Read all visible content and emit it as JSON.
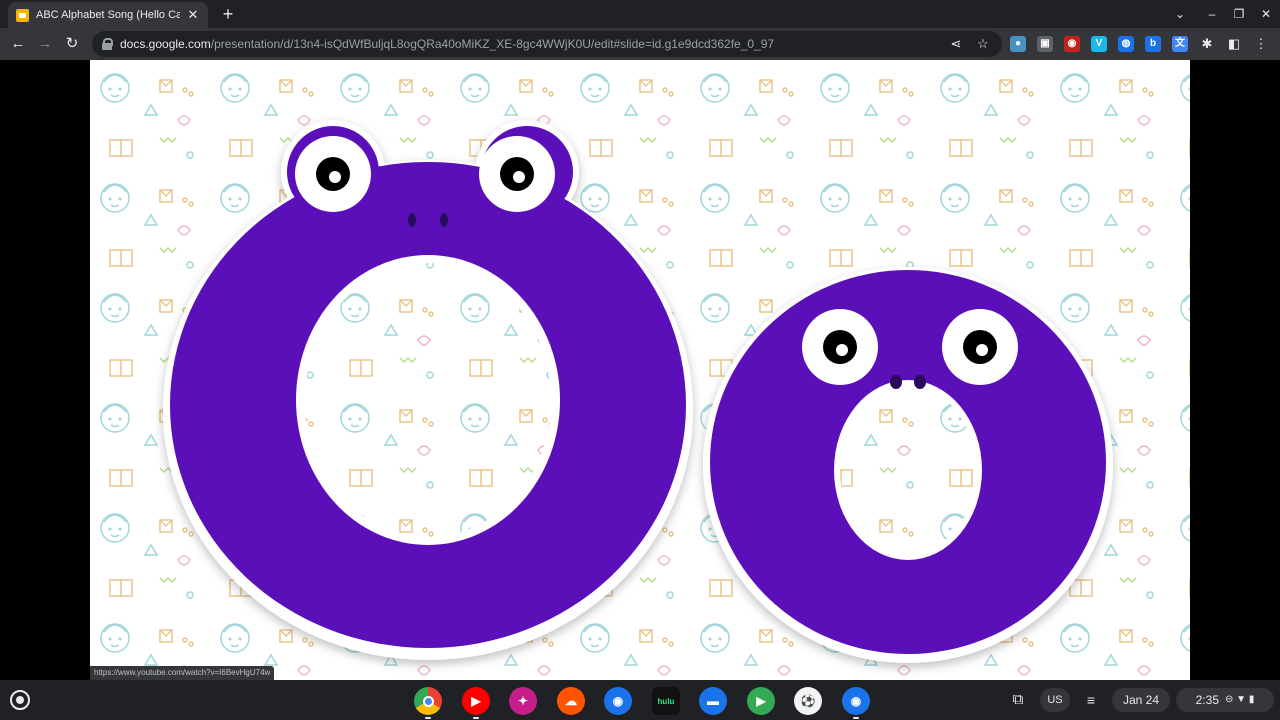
{
  "browser": {
    "tab_title": "ABC Alphabet Song (Hello Carri",
    "tab_close": "✕",
    "new_tab": "+",
    "window_controls": {
      "minimize": "–",
      "restore": "❐",
      "close": "✕",
      "dropdown": "⌄"
    },
    "url_host": "docs.google.com",
    "url_path": "/presentation/d/13n4-isQdWfBuljqL8ogQRa40oMiKZ_XE-8gc4WWjK0U/edit#slide=id.g1e9dcd362fe_0_97",
    "nav": {
      "back": "←",
      "forward": "→",
      "reload": "↻"
    },
    "omni_icons": {
      "share": "⋖",
      "bookmark": "☆"
    },
    "extensions": [
      {
        "name": "ext-camera",
        "label": "●",
        "color": "#4a90c2"
      },
      {
        "name": "ext-record",
        "label": "▣",
        "color": "#5f6368"
      },
      {
        "name": "ext-screen",
        "label": "◉",
        "color": "#c5221f"
      },
      {
        "name": "ext-vimeo",
        "label": "V",
        "color": "#1ab7ea"
      },
      {
        "name": "ext-globe",
        "label": "◍",
        "color": "#1a73e8"
      },
      {
        "name": "ext-bing",
        "label": "b",
        "color": "#1a73e8"
      },
      {
        "name": "ext-translate",
        "label": "文",
        "color": "#4285f4"
      }
    ],
    "puzzle_icon": "✱",
    "sidepanel_icon": "◧",
    "menu_icon": "⋮",
    "status_url": "https://www.youtube.com/watch?v=I6BevHgU74w"
  },
  "slide": {
    "big_letter": "O",
    "small_letter": "o",
    "letter_color": "#5b0fb8"
  },
  "shelf": {
    "apps": [
      {
        "name": "chrome-app",
        "label": "",
        "color": "#ea4335"
      },
      {
        "name": "youtube-app",
        "label": "▶",
        "color": "#ff0000"
      },
      {
        "name": "screencast-app",
        "label": "✦",
        "color": "#c51e8c"
      },
      {
        "name": "soundcloud-app",
        "label": "☁",
        "color": "#ff5500"
      },
      {
        "name": "camera-app",
        "label": "◉",
        "color": "#1a73e8"
      },
      {
        "name": "hulu-app",
        "label": "hulu",
        "color": "#111111"
      },
      {
        "name": "files-app",
        "label": "▬",
        "color": "#1a73e8"
      },
      {
        "name": "play-store-app",
        "label": "▶",
        "color": "#34a853"
      },
      {
        "name": "soccer-app",
        "label": "⚽",
        "color": "#f1f3f4"
      },
      {
        "name": "screen-capture-app",
        "label": "◉",
        "color": "#1a73e8"
      }
    ],
    "tray": {
      "clipboard": "⧉",
      "ime": "US",
      "playlist": "≡",
      "date": "Jan 24",
      "time": "2:35",
      "status_icons": "⊖ ▼ ▮"
    }
  }
}
